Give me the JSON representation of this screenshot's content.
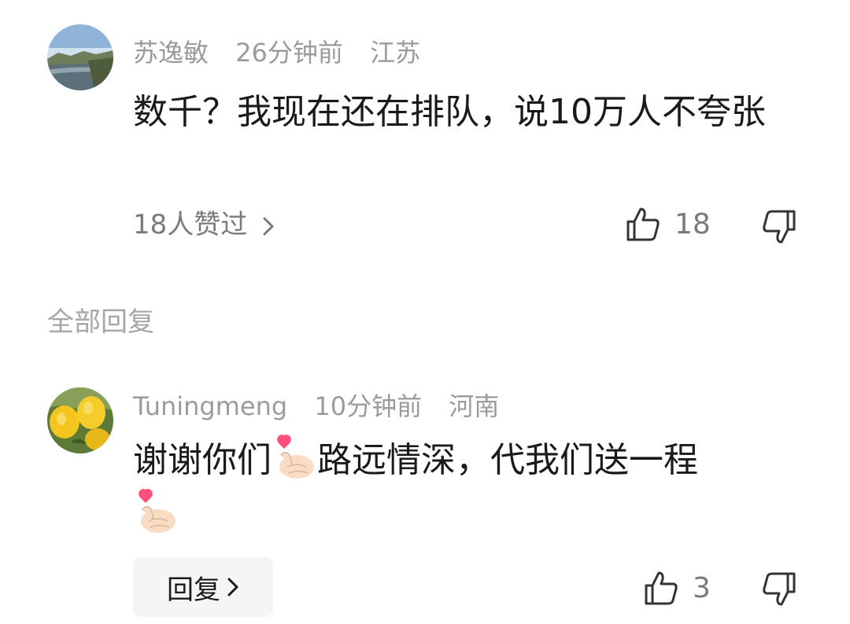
{
  "comment": {
    "author": "苏逸敏",
    "time": "26分钟前",
    "location": "江苏",
    "text": "数千？我现在还在排队，说10万人不夸张",
    "likes_link": "18人赞过",
    "like_count": "18",
    "avatar_icon": "landscape-avatar-icon"
  },
  "replies_section": {
    "title": "全部回复"
  },
  "reply": {
    "author": "Tuningmeng",
    "time": "10分钟前",
    "location": "河南",
    "text_part1": "谢谢你们",
    "text_part2": "路远情深，代我们送一程",
    "reply_button": "回复",
    "like_count": "3",
    "avatar_icon": "lemon-avatar-icon",
    "emoji_icon": "finger-heart-emoji"
  },
  "colors": {
    "meta_gray": "#9b9b9b",
    "text_dark": "#1a1a1a",
    "button_bg": "#f5f5f5"
  }
}
